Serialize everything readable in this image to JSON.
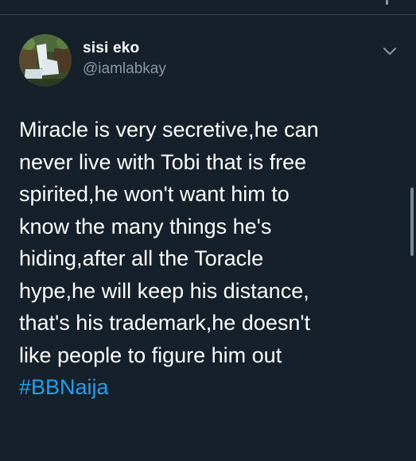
{
  "tweet": {
    "author": {
      "display_name": "sisi eko",
      "handle": "@iamlabkay",
      "avatar_icon": "waterfall-avatar"
    },
    "menu_icon": "chevron-down-icon",
    "text_lines": [
      "Miracle is very secretive,he can",
      "never live with Tobi that is free",
      "spirited,he won't want him to",
      "know the many things he's",
      "hiding,after all the Toracle",
      "hype,he will keep his distance,",
      "that's his trademark,he doesn't",
      "like people to figure him out"
    ],
    "hashtag": "#BBNaija"
  },
  "colors": {
    "background": "#15202b",
    "text": "#ffffff",
    "secondary_text": "#8899a6",
    "accent": "#1da1f2",
    "divider": "#38444d"
  }
}
